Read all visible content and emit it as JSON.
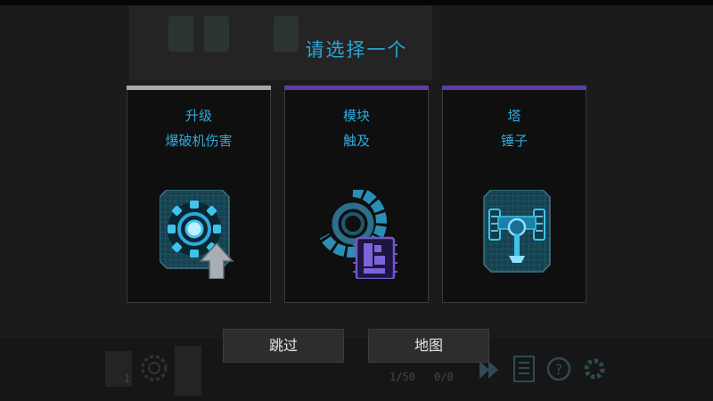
{
  "dialog": {
    "title": "请选择一个"
  },
  "cards": [
    {
      "category": "升级",
      "name": "爆破机伤害",
      "bar_color": "#a8a8a8",
      "icon": "reactor-core-upgrade-icon"
    },
    {
      "category": "模块",
      "name": "触及",
      "bar_color": "#5b3ea8",
      "icon": "range-ring-chip-icon"
    },
    {
      "category": "塔",
      "name": "锤子",
      "bar_color": "#5b3ea8",
      "icon": "hammer-tower-icon"
    }
  ],
  "buttons": {
    "skip": "跳过",
    "map": "地图"
  },
  "background_hud": {
    "count": "1",
    "wave": "1/50",
    "score": "0/0",
    "icons": [
      "gear-outline-icon",
      "fast-forward-icon",
      "list-icon",
      "help-icon",
      "settings-icon"
    ]
  }
}
